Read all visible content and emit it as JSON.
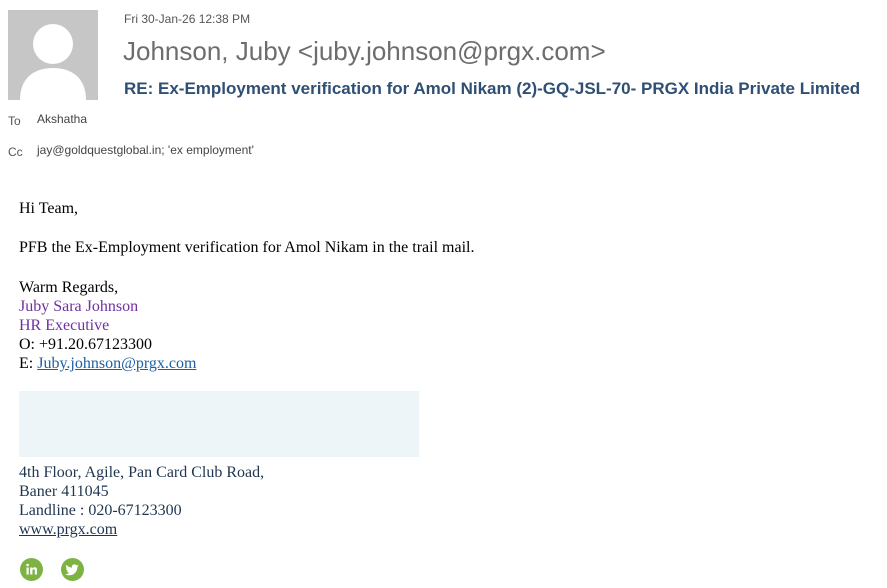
{
  "header": {
    "sent_time": "Fri 30-Jan-26 12:38 PM",
    "sender": "Johnson, Juby <juby.johnson@prgx.com>",
    "subject": "RE: Ex-Employment verification for Amol Nikam (2)-GQ-JSL-70- PRGX India Private Limited",
    "to_label": "To",
    "to_value": "Akshatha",
    "cc_label": "Cc",
    "cc_value": "jay@goldquestglobal.in; 'ex employment'"
  },
  "body": {
    "greeting": "Hi Team,",
    "message": "PFB the Ex-Employment verification for Amol Nikam in the trail mail.",
    "closing": "Warm Regards,",
    "signature_name": "Juby Sara Johnson",
    "signature_title": "HR Executive",
    "phone": "O: +91.20.67123300",
    "email_prefix": "E: ",
    "email_link": "Juby.johnson@prgx.com",
    "address_line1": "4th Floor, Agile, Pan Card Club Road,",
    "address_line2": "Baner 411045",
    "landline": "Landline : 020-67123300",
    "website": "www.prgx.com"
  },
  "icons": {
    "avatar": "person-silhouette-icon",
    "social": [
      "linkedin-icon",
      "twitter-icon"
    ],
    "social_color": "#7cb342"
  },
  "colors": {
    "subject": "#2f4f74",
    "signature": "#7030a0",
    "link": "#1f5fa0"
  }
}
